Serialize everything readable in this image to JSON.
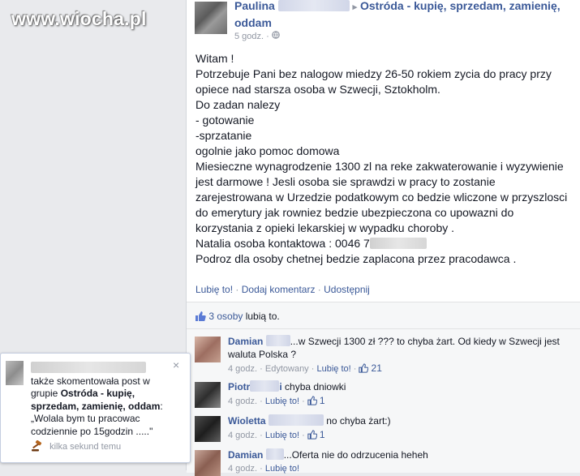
{
  "watermark": "www.wiocha.pl",
  "post": {
    "author": "Paulina",
    "separator": "▸",
    "group": "Ostróda - kupię, sprzedam, zamienię, oddam",
    "time": "5 godz.",
    "audience_icon": "globe-icon",
    "body_lines": [
      "Witam !",
      "Potrzebuje Pani bez nalogow miedzy 26-50 rokiem zycia do pracy przy opiece nad starsza osoba w Szwecji, Sztokholm.",
      "Do zadan nalezy",
      "- gotowanie",
      "-sprzatanie",
      "ogolnie jako pomoc domowa",
      "Miesieczne wynagrodzenie 1300 zl na reke zakwaterowanie i wyzywienie jest darmowe ! Jesli osoba sie sprawdzi w pracy to zostanie zarejestrowana w Urzedzie podatkowym co bedzie wliczone w przyszlosci do emerytury jak rowniez bedzie ubezpieczona co upowazni do korzystania z opieki lekarskiej w wypadku choroby ."
    ],
    "contact_line": "Natalia osoba kontaktowa : 0046 7",
    "last_line": "Podroz dla osoby chetnej bedzie zaplacona przez pracodawca .",
    "actions": {
      "like": "Lubię to!",
      "comment": "Dodaj komentarz",
      "share": "Udostępnij",
      "dot": "·"
    },
    "likes": {
      "count_link": "3 osoby",
      "suffix": "lubią to."
    }
  },
  "comments": [
    {
      "name": "Damian",
      "text": "...w Szwecji 1300 zł ??? to chyba żart. Od kiedy w Szwecji jest waluta Polska ?",
      "time": "4 godz.",
      "edited": "Edytowany",
      "like": "Lubię to!",
      "likes": "21"
    },
    {
      "name": "Piotr",
      "name_tail": "i",
      "text": "chyba dniowki",
      "time": "4 godz.",
      "like": "Lubię to!",
      "likes": "1"
    },
    {
      "name": "Wioletta",
      "text": "no chyba żart:)",
      "time": "4 godz.",
      "like": "Lubię to!",
      "likes": "1"
    },
    {
      "name": "Damian",
      "text": "...Oferta nie do odrzucenia heheh",
      "time": "4 godz.",
      "like": "Lubię to!"
    }
  ],
  "notification": {
    "line1": "także skomentowała post w grupie",
    "group": "Ostróda - kupię, sprzedam, zamienię, oddam",
    "quote": "„Wolala bym tu pracowac codziennie po 15godzin .....\"",
    "time": "kilka sekund temu",
    "close": "×",
    "icon": "gavel-icon"
  },
  "colors": {
    "link": "#3b5998",
    "meta": "#9197a3",
    "background": "#e9eaed"
  }
}
